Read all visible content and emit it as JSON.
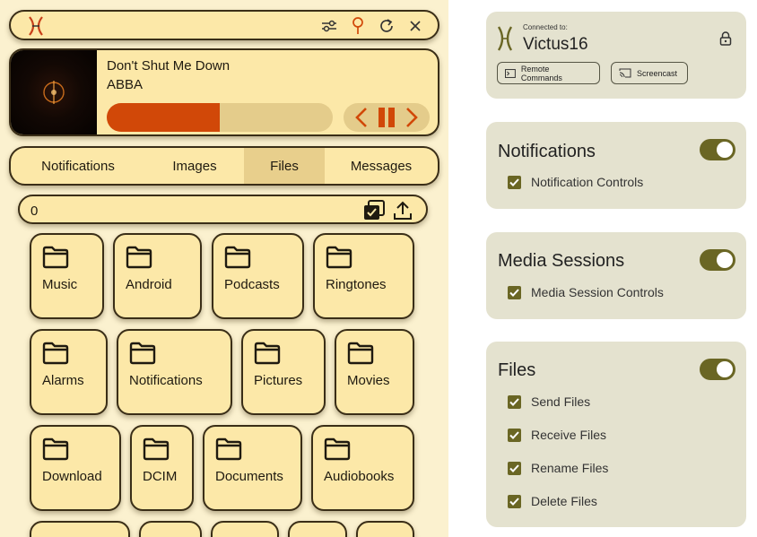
{
  "app": {
    "logo_icon": "x-strand-logo-icon",
    "titlebar_icons": [
      "sliders-icon",
      "pin-icon",
      "refresh-icon",
      "close-icon"
    ]
  },
  "player": {
    "title": "Don't Shut Me Down",
    "artist": "ABBA",
    "progress_fraction": 0.5,
    "controls": [
      "previous-icon",
      "pause-icon",
      "next-icon"
    ]
  },
  "tabs": [
    {
      "label": "Notifications",
      "active": false
    },
    {
      "label": "Images",
      "active": false
    },
    {
      "label": "Files",
      "active": true
    },
    {
      "label": "Messages",
      "active": false
    }
  ],
  "path_bar": {
    "text": "0"
  },
  "folders": [
    {
      "name": "Music"
    },
    {
      "name": "Android"
    },
    {
      "name": "Podcasts"
    },
    {
      "name": "Ringtones"
    },
    {
      "name": "Alarms"
    },
    {
      "name": "Notifications"
    },
    {
      "name": "Pictures"
    },
    {
      "name": "Movies"
    },
    {
      "name": "Download"
    },
    {
      "name": "DCIM"
    },
    {
      "name": "Documents"
    },
    {
      "name": "Audiobooks"
    }
  ],
  "settings": {
    "device": {
      "connected_label": "Connected to:",
      "name": "Victus16",
      "remote_commands_label": "Remote Commands",
      "screencast_label": "Screencast"
    },
    "notifications": {
      "title": "Notifications",
      "enabled": true,
      "options": [
        {
          "label": "Notification Controls",
          "checked": true
        }
      ]
    },
    "media": {
      "title": "Media Sessions",
      "enabled": true,
      "options": [
        {
          "label": "Media Session Controls",
          "checked": true
        }
      ]
    },
    "files": {
      "title": "Files",
      "enabled": true,
      "options": [
        {
          "label": "Send Files",
          "checked": true
        },
        {
          "label": "Receive Files",
          "checked": true
        },
        {
          "label": "Rename Files",
          "checked": true
        },
        {
          "label": "Delete Files",
          "checked": true
        }
      ]
    }
  },
  "colors": {
    "accent_orange": "#d14808",
    "card_bg": "#fce8a8",
    "toggle_olive": "#6a6624"
  }
}
